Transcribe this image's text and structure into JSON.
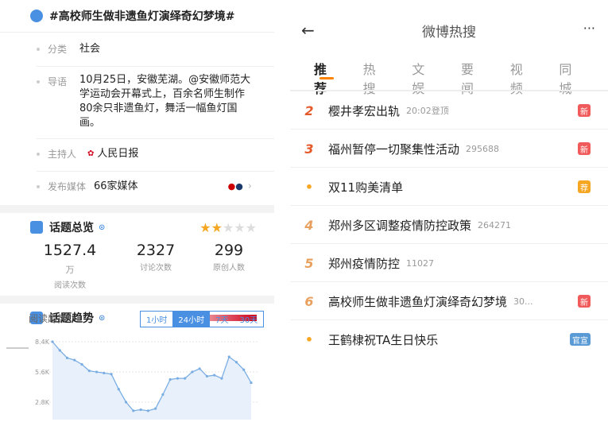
{
  "left": {
    "topic_title": "#高校师生做非遗鱼灯演绎奇幻梦境#",
    "info": {
      "category_key": "分类",
      "category_val": "社会",
      "intro_key": "导语",
      "intro_val": "10月25日，安徽芜湖。@安徽师范大学运动会开幕式上，百余名师生制作80余只非遗鱼灯，舞活一幅鱼灯国画。",
      "host_key": "主持人",
      "host_val": "人民日报",
      "media_key": "发布媒体",
      "media_val": "66家媒体"
    },
    "overview": {
      "title": "话题总览",
      "stars": 2,
      "stats": [
        {
          "num": "1527.4",
          "unit": "万",
          "label": "阅读次数"
        },
        {
          "num": "2327",
          "unit": "",
          "label": "讨论次数"
        },
        {
          "num": "299",
          "unit": "",
          "label": "原创人数"
        }
      ]
    },
    "trend": {
      "title": "话题趋势",
      "subtitle": "阅读趋势",
      "ranges": [
        "1小时",
        "24小时",
        "7天",
        "30天"
      ],
      "active_range": "24小时",
      "chart_data": {
        "type": "line",
        "y_ticks": [
          "8.4K",
          "5.6K",
          "2.8K"
        ],
        "ylim": [
          2800,
          8400
        ],
        "x": [
          0,
          1,
          2,
          3,
          4,
          5,
          6,
          7,
          8,
          9,
          10,
          11,
          12,
          13,
          14,
          15,
          16,
          17,
          18,
          19,
          20,
          21,
          22,
          23,
          24,
          25,
          26,
          27
        ],
        "values": [
          8400,
          7600,
          6900,
          6700,
          6300,
          5700,
          5600,
          5500,
          5400,
          4000,
          2800,
          2000,
          2100,
          2000,
          2200,
          3500,
          4900,
          5000,
          5000,
          5600,
          5900,
          5200,
          5300,
          5000,
          7000,
          6500,
          5800,
          4600
        ]
      }
    }
  },
  "right": {
    "nav_title": "微博热搜",
    "back_icon": "←",
    "more_icon": "···",
    "tabs": [
      "推荐",
      "热搜",
      "文娱",
      "要闻",
      "视频",
      "同城"
    ],
    "active_tab": "推荐",
    "items": [
      {
        "rank": "2",
        "title": "樱井孝宏出轨",
        "meta": "20:02登顶",
        "badge": "新",
        "badge_color": "#f05a5a"
      },
      {
        "rank": "3",
        "title": "福州暂停一切聚集性活动",
        "meta": "295688",
        "badge": "新",
        "badge_color": "#f05a5a"
      },
      {
        "rank": "•",
        "title": "双11购美清单",
        "meta": "",
        "badge": "荐",
        "badge_color": "#f5a623"
      },
      {
        "rank": "4",
        "title": "郑州多区调整疫情防控政策",
        "meta": "264271",
        "badge": "",
        "badge_color": ""
      },
      {
        "rank": "5",
        "title": "郑州疫情防控",
        "meta": "11027",
        "badge": "",
        "badge_color": ""
      },
      {
        "rank": "6",
        "title": "高校师生做非遗鱼灯演绎奇幻梦境",
        "meta": "30...",
        "badge": "新",
        "badge_color": "#f05a5a"
      },
      {
        "rank": "•",
        "title": "王鹤棣祝TA生日快乐",
        "meta": "",
        "badge": "官宣",
        "badge_color": "#5b9bd5"
      }
    ]
  }
}
